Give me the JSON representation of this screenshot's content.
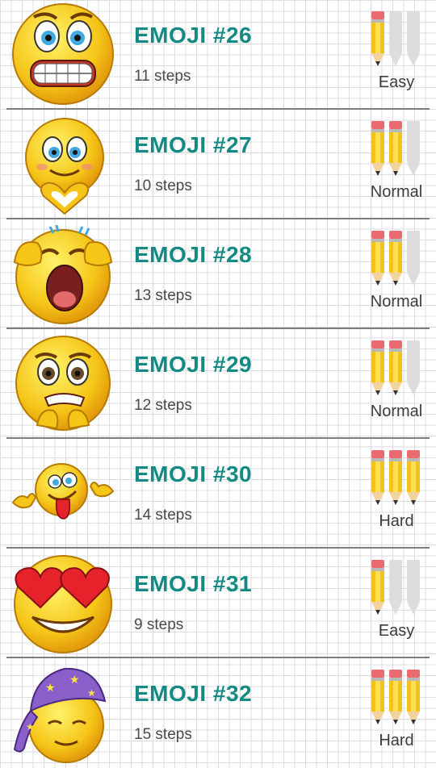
{
  "items": [
    {
      "title": "EMOJI #26",
      "steps": "11 steps",
      "difficulty": "Easy",
      "pencils": 1,
      "face": "grimace"
    },
    {
      "title": "EMOJI #27",
      "steps": "10 steps",
      "difficulty": "Normal",
      "pencils": 2,
      "face": "heart-hands"
    },
    {
      "title": "EMOJI #28",
      "steps": "13 steps",
      "difficulty": "Normal",
      "pencils": 2,
      "face": "crying"
    },
    {
      "title": "EMOJI #29",
      "steps": "12 steps",
      "difficulty": "Normal",
      "pencils": 2,
      "face": "nervous"
    },
    {
      "title": "EMOJI #30",
      "steps": "14 steps",
      "difficulty": "Hard",
      "pencils": 3,
      "face": "tongue-out"
    },
    {
      "title": "EMOJI #31",
      "steps": "9 steps",
      "difficulty": "Easy",
      "pencils": 1,
      "face": "heart-eyes"
    },
    {
      "title": "EMOJI #32",
      "steps": "15 steps",
      "difficulty": "Hard",
      "pencils": 3,
      "face": "sleepy-nightcap"
    }
  ],
  "colors": {
    "title": "#138a84",
    "face": "#f5c518",
    "pencil_body": "#f3c21b",
    "pencil_eraser": "#e96a6f",
    "pencil_empty": "#dddddd",
    "heart": "#e6222a",
    "nightcap": "#8a5fc9"
  }
}
